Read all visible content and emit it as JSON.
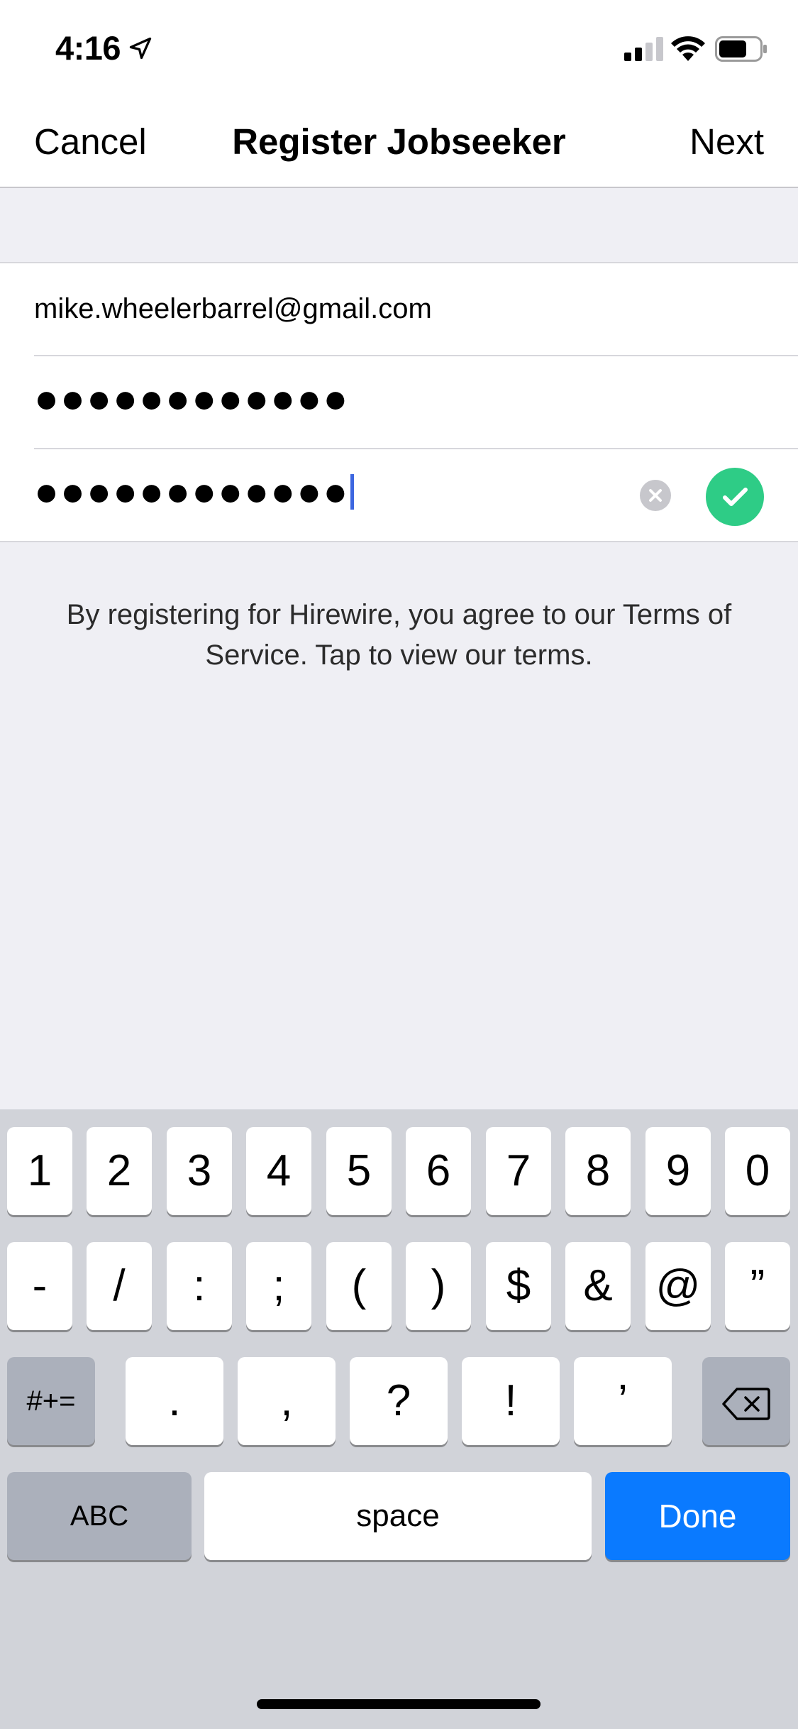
{
  "status": {
    "time": "4:16"
  },
  "nav": {
    "cancel": "Cancel",
    "title": "Register Jobseeker",
    "next": "Next"
  },
  "form": {
    "email": "mike.wheelerbarrel@gmail.com",
    "password_masked": "●●●●●●●●●●●●",
    "confirm_masked": "●●●●●●●●●●●●"
  },
  "terms_text": "By registering for Hirewire, you agree to our Terms of Service. Tap to view our terms.",
  "keyboard": {
    "row1": [
      "1",
      "2",
      "3",
      "4",
      "5",
      "6",
      "7",
      "8",
      "9",
      "0"
    ],
    "row2": [
      "-",
      "/",
      ":",
      ";",
      "(",
      ")",
      "$",
      "&",
      "@",
      "”"
    ],
    "symbols_key": "#+=",
    "row3": [
      ".",
      ",",
      "?",
      "!",
      "’"
    ],
    "abc_key": "ABC",
    "space_key": "space",
    "done_key": "Done"
  },
  "colors": {
    "accent_blue": "#0a7aff",
    "confirm_green": "#2ecc86",
    "cursor": "#3c66e0"
  }
}
